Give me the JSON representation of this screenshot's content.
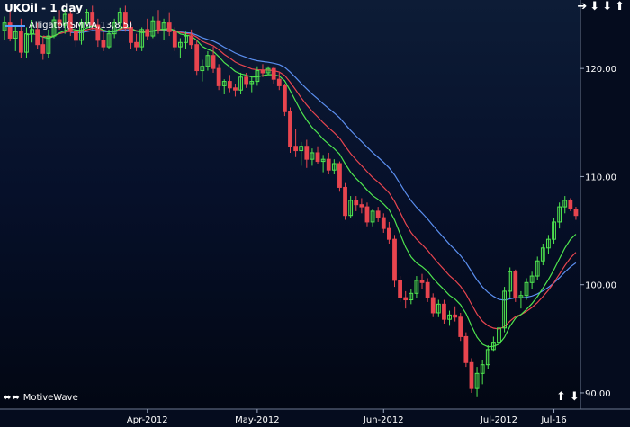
{
  "title": "UKOil - 1 day",
  "legend": {
    "label": "Alligator(SMMA,13,8,5)"
  },
  "watermark": "MotiveWave",
  "nav": {
    "top_icons": [
      "arrow-right-icon",
      "arrow-down-icon",
      "arrow-down-icon",
      "arrow-up-icon"
    ],
    "bottom_icons": [
      "arrow-up-icon",
      "arrow-down-icon"
    ],
    "watermark_icons": [
      "arrow-left-right-icon",
      "arrow-left-right-icon"
    ]
  },
  "colors": {
    "up": "#4fe64f",
    "down": "#e8454f",
    "jaw": "#5b8ff0",
    "teeth": "#e8454f",
    "lips": "#4fe64f",
    "grid": "#1f2c4a",
    "text": "#ffffff"
  },
  "chart_data": {
    "type": "candlestick",
    "x_labels": [
      "Apr-2012",
      "May-2012",
      "Jun-2012",
      "Jul-2012",
      "Jul-16"
    ],
    "x_label_dates": [
      "2012-04-02",
      "2012-05-01",
      "2012-06-01",
      "2012-07-02",
      "2012-07-16"
    ],
    "ylim": [
      88.5,
      125.5
    ],
    "yticks": [
      {
        "value": 90,
        "label": "90.00"
      },
      {
        "value": 100,
        "label": "100.00"
      },
      {
        "value": 110,
        "label": "110.00"
      },
      {
        "value": 120,
        "label": "120.00"
      }
    ],
    "dates": [
      "2012-02-24",
      "2012-02-27",
      "2012-02-28",
      "2012-02-29",
      "2012-03-01",
      "2012-03-02",
      "2012-03-05",
      "2012-03-06",
      "2012-03-07",
      "2012-03-08",
      "2012-03-09",
      "2012-03-12",
      "2012-03-13",
      "2012-03-14",
      "2012-03-15",
      "2012-03-16",
      "2012-03-19",
      "2012-03-20",
      "2012-03-21",
      "2012-03-22",
      "2012-03-23",
      "2012-03-26",
      "2012-03-27",
      "2012-03-28",
      "2012-03-29",
      "2012-03-30",
      "2012-04-02",
      "2012-04-03",
      "2012-04-04",
      "2012-04-05",
      "2012-04-09",
      "2012-04-10",
      "2012-04-11",
      "2012-04-12",
      "2012-04-13",
      "2012-04-16",
      "2012-04-17",
      "2012-04-18",
      "2012-04-19",
      "2012-04-20",
      "2012-04-23",
      "2012-04-24",
      "2012-04-25",
      "2012-04-26",
      "2012-04-27",
      "2012-04-30",
      "2012-05-01",
      "2012-05-02",
      "2012-05-03",
      "2012-05-04",
      "2012-05-07",
      "2012-05-08",
      "2012-05-09",
      "2012-05-10",
      "2012-05-11",
      "2012-05-14",
      "2012-05-15",
      "2012-05-16",
      "2012-05-17",
      "2012-05-18",
      "2012-05-21",
      "2012-05-22",
      "2012-05-23",
      "2012-05-24",
      "2012-05-25",
      "2012-05-28",
      "2012-05-29",
      "2012-05-30",
      "2012-05-31",
      "2012-06-01",
      "2012-06-04",
      "2012-06-05",
      "2012-06-06",
      "2012-06-07",
      "2012-06-08",
      "2012-06-11",
      "2012-06-12",
      "2012-06-13",
      "2012-06-14",
      "2012-06-15",
      "2012-06-18",
      "2012-06-19",
      "2012-06-20",
      "2012-06-21",
      "2012-06-22",
      "2012-06-25",
      "2012-06-26",
      "2012-06-27",
      "2012-06-28",
      "2012-06-29",
      "2012-07-02",
      "2012-07-03",
      "2012-07-04",
      "2012-07-05",
      "2012-07-06",
      "2012-07-09",
      "2012-07-10",
      "2012-07-11",
      "2012-07-12",
      "2012-07-13",
      "2012-07-16",
      "2012-07-17",
      "2012-07-18",
      "2012-07-19",
      "2012-07-20"
    ],
    "ohlc": [
      [
        123.5,
        124.8,
        122.6,
        124.2
      ],
      [
        124.2,
        125.3,
        122.5,
        122.8
      ],
      [
        122.8,
        124.0,
        121.6,
        123.4
      ],
      [
        123.4,
        124.6,
        121.0,
        121.5
      ],
      [
        121.5,
        123.8,
        121.0,
        123.2
      ],
      [
        123.2,
        124.5,
        122.4,
        123.6
      ],
      [
        123.6,
        124.2,
        121.8,
        122.2
      ],
      [
        122.2,
        123.0,
        120.8,
        121.4
      ],
      [
        121.4,
        123.6,
        121.0,
        123.0
      ],
      [
        123.0,
        124.8,
        122.8,
        124.5
      ],
      [
        124.5,
        125.4,
        123.6,
        124.0
      ],
      [
        124.0,
        125.5,
        123.2,
        125.0
      ],
      [
        125.0,
        125.6,
        123.0,
        123.4
      ],
      [
        123.4,
        124.2,
        122.0,
        122.6
      ],
      [
        122.6,
        124.6,
        122.2,
        124.2
      ],
      [
        124.2,
        125.5,
        123.8,
        125.2
      ],
      [
        125.2,
        125.8,
        123.6,
        124.0
      ],
      [
        124.0,
        124.6,
        122.0,
        122.6
      ],
      [
        122.6,
        123.4,
        121.6,
        122.0
      ],
      [
        122.0,
        123.6,
        121.8,
        123.2
      ],
      [
        123.2,
        124.6,
        122.8,
        124.2
      ],
      [
        124.2,
        125.6,
        123.8,
        125.2
      ],
      [
        125.2,
        125.8,
        123.4,
        123.8
      ],
      [
        123.8,
        124.4,
        121.8,
        122.4
      ],
      [
        122.4,
        123.2,
        121.6,
        122.0
      ],
      [
        122.0,
        123.8,
        121.6,
        123.6
      ],
      [
        123.6,
        124.6,
        122.6,
        123.0
      ],
      [
        123.0,
        124.8,
        122.8,
        124.4
      ],
      [
        124.4,
        125.4,
        123.2,
        123.6
      ],
      [
        123.6,
        124.6,
        122.6,
        124.2
      ],
      [
        124.2,
        125.2,
        123.0,
        123.4
      ],
      [
        123.4,
        123.8,
        121.6,
        122.0
      ],
      [
        122.0,
        122.8,
        121.0,
        122.4
      ],
      [
        122.4,
        123.4,
        121.8,
        123.0
      ],
      [
        123.0,
        123.6,
        121.8,
        122.2
      ],
      [
        122.2,
        122.6,
        119.4,
        119.8
      ],
      [
        119.8,
        120.8,
        118.8,
        120.2
      ],
      [
        120.2,
        121.6,
        119.8,
        121.2
      ],
      [
        121.2,
        122.0,
        119.6,
        120.0
      ],
      [
        120.0,
        120.4,
        118.0,
        118.4
      ],
      [
        118.4,
        119.0,
        117.6,
        118.8
      ],
      [
        118.8,
        119.4,
        117.8,
        118.2
      ],
      [
        118.2,
        118.6,
        117.4,
        118.0
      ],
      [
        118.0,
        119.6,
        117.6,
        119.2
      ],
      [
        119.2,
        119.6,
        118.2,
        118.6
      ],
      [
        118.6,
        119.2,
        117.8,
        118.8
      ],
      [
        118.8,
        120.2,
        118.4,
        119.8
      ],
      [
        119.8,
        120.4,
        119.2,
        119.6
      ],
      [
        119.6,
        120.2,
        119.4,
        120.0
      ],
      [
        120.0,
        120.2,
        118.6,
        119.0
      ],
      [
        119.0,
        119.6,
        118.0,
        118.4
      ],
      [
        118.4,
        118.6,
        115.6,
        116.0
      ],
      [
        116.0,
        116.4,
        112.2,
        112.8
      ],
      [
        112.8,
        114.4,
        111.8,
        112.4
      ],
      [
        112.4,
        113.2,
        111.0,
        112.8
      ],
      [
        112.8,
        113.4,
        110.8,
        111.6
      ],
      [
        111.6,
        112.6,
        111.0,
        112.2
      ],
      [
        112.2,
        112.8,
        111.2,
        111.4
      ],
      [
        111.4,
        112.0,
        110.4,
        111.6
      ],
      [
        111.6,
        112.2,
        110.2,
        110.6
      ],
      [
        110.6,
        111.6,
        110.2,
        111.2
      ],
      [
        111.2,
        111.4,
        108.6,
        109.0
      ],
      [
        109.0,
        109.4,
        106.0,
        106.4
      ],
      [
        106.4,
        108.2,
        106.2,
        107.8
      ],
      [
        107.8,
        108.2,
        106.8,
        107.4
      ],
      [
        107.4,
        108.0,
        106.6,
        107.2
      ],
      [
        107.2,
        107.6,
        105.4,
        105.8
      ],
      [
        105.8,
        107.0,
        105.4,
        106.8
      ],
      [
        106.8,
        107.2,
        105.8,
        106.2
      ],
      [
        106.2,
        106.6,
        104.8,
        105.2
      ],
      [
        105.2,
        105.8,
        103.8,
        104.2
      ],
      [
        104.2,
        104.6,
        99.8,
        100.4
      ],
      [
        100.4,
        100.8,
        98.4,
        98.8
      ],
      [
        98.8,
        99.4,
        97.8,
        98.6
      ],
      [
        98.6,
        99.6,
        98.2,
        99.2
      ],
      [
        99.2,
        100.8,
        98.8,
        100.4
      ],
      [
        100.4,
        101.0,
        99.6,
        100.2
      ],
      [
        100.2,
        100.6,
        98.4,
        98.8
      ],
      [
        98.8,
        99.2,
        97.0,
        97.4
      ],
      [
        97.4,
        98.6,
        97.0,
        98.2
      ],
      [
        98.2,
        98.6,
        96.4,
        96.8
      ],
      [
        96.8,
        97.6,
        96.2,
        97.2
      ],
      [
        97.2,
        98.0,
        96.6,
        97.0
      ],
      [
        97.0,
        97.4,
        94.8,
        95.2
      ],
      [
        95.2,
        95.6,
        92.4,
        92.8
      ],
      [
        92.8,
        93.2,
        90.0,
        90.4
      ],
      [
        90.4,
        92.4,
        89.6,
        91.8
      ],
      [
        91.8,
        93.0,
        90.8,
        92.6
      ],
      [
        92.6,
        94.4,
        92.2,
        94.0
      ],
      [
        94.0,
        95.2,
        93.8,
        94.6
      ],
      [
        94.6,
        96.4,
        94.2,
        96.0
      ],
      [
        96.0,
        99.8,
        95.6,
        99.4
      ],
      [
        99.4,
        101.6,
        98.8,
        101.2
      ],
      [
        101.2,
        101.4,
        98.4,
        98.8
      ],
      [
        98.8,
        99.4,
        97.8,
        99.0
      ],
      [
        99.0,
        100.6,
        98.6,
        100.2
      ],
      [
        100.2,
        101.2,
        99.6,
        100.8
      ],
      [
        100.8,
        102.6,
        100.4,
        102.2
      ],
      [
        102.2,
        103.8,
        101.8,
        103.4
      ],
      [
        103.4,
        104.6,
        102.8,
        104.2
      ],
      [
        104.2,
        106.2,
        103.8,
        105.8
      ],
      [
        105.8,
        107.6,
        105.2,
        107.2
      ],
      [
        107.2,
        108.2,
        106.6,
        107.8
      ],
      [
        107.8,
        108.0,
        106.8,
        107.0
      ],
      [
        107.0,
        107.2,
        106.0,
        106.4
      ]
    ],
    "indicators": {
      "label": "Alligator(SMMA,13,8,5)",
      "jaw": {
        "period": 13,
        "color": "#5b8ff0"
      },
      "teeth": {
        "period": 8,
        "color": "#e8454f"
      },
      "lips": {
        "period": 5,
        "color": "#4fe64f"
      }
    },
    "grid": false
  }
}
